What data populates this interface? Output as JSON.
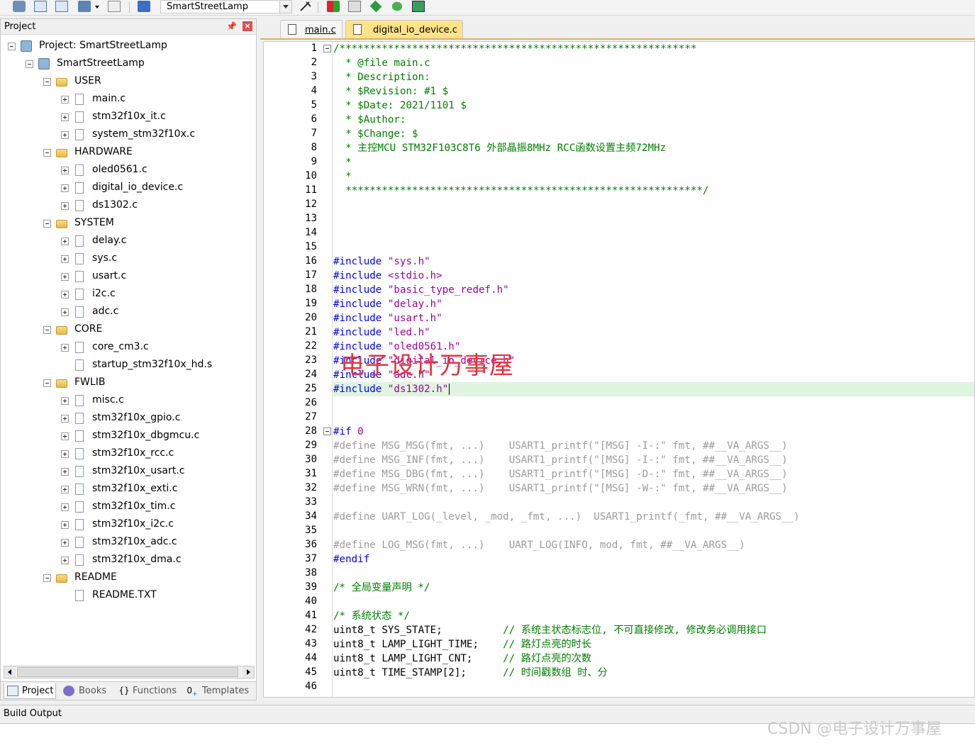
{
  "toolbar": {
    "target_name": "SmartStreetLamp",
    "icons": [
      "build-icon",
      "rebuild-icon",
      "batch-build-icon",
      "download-icon",
      "options-icon",
      "load-icon",
      "manage-icon",
      "select-packs-icon",
      "pack-installer-icon",
      "run-env-icon",
      "mgr-icon",
      "tools-icon"
    ]
  },
  "project_pane": {
    "title": "Project",
    "tree": [
      {
        "label": "Project: SmartStreetLamp",
        "kind": "project",
        "level": 0,
        "expander": "minus"
      },
      {
        "label": "SmartStreetLamp",
        "kind": "target",
        "level": 1,
        "expander": "minus"
      },
      {
        "label": "USER",
        "kind": "folder",
        "level": 2,
        "expander": "minus"
      },
      {
        "label": "main.c",
        "kind": "file",
        "level": 3,
        "expander": "plus"
      },
      {
        "label": "stm32f10x_it.c",
        "kind": "file",
        "level": 3,
        "expander": "plus"
      },
      {
        "label": "system_stm32f10x.c",
        "kind": "file",
        "level": 3,
        "expander": "plus"
      },
      {
        "label": "HARDWARE",
        "kind": "folder",
        "level": 2,
        "expander": "minus"
      },
      {
        "label": "oled0561.c",
        "kind": "file",
        "level": 3,
        "expander": "plus"
      },
      {
        "label": "digital_io_device.c",
        "kind": "file",
        "level": 3,
        "expander": "plus"
      },
      {
        "label": "ds1302.c",
        "kind": "file",
        "level": 3,
        "expander": "plus"
      },
      {
        "label": "SYSTEM",
        "kind": "folder",
        "level": 2,
        "expander": "minus"
      },
      {
        "label": "delay.c",
        "kind": "file",
        "level": 3,
        "expander": "plus"
      },
      {
        "label": "sys.c",
        "kind": "file",
        "level": 3,
        "expander": "plus"
      },
      {
        "label": "usart.c",
        "kind": "file",
        "level": 3,
        "expander": "plus"
      },
      {
        "label": "i2c.c",
        "kind": "file",
        "level": 3,
        "expander": "plus"
      },
      {
        "label": "adc.c",
        "kind": "file",
        "level": 3,
        "expander": "plus"
      },
      {
        "label": "CORE",
        "kind": "folder",
        "level": 2,
        "expander": "minus"
      },
      {
        "label": "core_cm3.c",
        "kind": "file",
        "level": 3,
        "expander": "plus"
      },
      {
        "label": "startup_stm32f10x_hd.s",
        "kind": "file",
        "level": 3,
        "expander": "none"
      },
      {
        "label": "FWLIB",
        "kind": "folder",
        "level": 2,
        "expander": "minus"
      },
      {
        "label": "misc.c",
        "kind": "file",
        "level": 3,
        "expander": "plus"
      },
      {
        "label": "stm32f10x_gpio.c",
        "kind": "file",
        "level": 3,
        "expander": "plus"
      },
      {
        "label": "stm32f10x_dbgmcu.c",
        "kind": "file",
        "level": 3,
        "expander": "plus"
      },
      {
        "label": "stm32f10x_rcc.c",
        "kind": "file",
        "level": 3,
        "expander": "plus"
      },
      {
        "label": "stm32f10x_usart.c",
        "kind": "file",
        "level": 3,
        "expander": "plus"
      },
      {
        "label": "stm32f10x_exti.c",
        "kind": "file",
        "level": 3,
        "expander": "plus"
      },
      {
        "label": "stm32f10x_tim.c",
        "kind": "file",
        "level": 3,
        "expander": "plus"
      },
      {
        "label": "stm32f10x_i2c.c",
        "kind": "file",
        "level": 3,
        "expander": "plus"
      },
      {
        "label": "stm32f10x_adc.c",
        "kind": "file",
        "level": 3,
        "expander": "plus"
      },
      {
        "label": "stm32f10x_dma.c",
        "kind": "file",
        "level": 3,
        "expander": "plus"
      },
      {
        "label": "README",
        "kind": "folder",
        "level": 2,
        "expander": "minus"
      },
      {
        "label": "README.TXT",
        "kind": "file",
        "level": 3,
        "expander": "none"
      }
    ],
    "tabs": [
      {
        "label": "Project",
        "icon": "project-icon",
        "active": true
      },
      {
        "label": "Books",
        "icon": "books-icon",
        "active": false
      },
      {
        "label": "Functions",
        "icon": "functions-icon",
        "active": false
      },
      {
        "label": "Templates",
        "icon": "templates-icon",
        "active": false
      }
    ]
  },
  "editor": {
    "tabs": [
      {
        "label": "main.c",
        "active": false
      },
      {
        "label": "digital_io_device.c",
        "active": true
      }
    ],
    "highlight_line": 25,
    "fold_lines": [
      1,
      28
    ],
    "lines": [
      [
        [
          "cm",
          "/***********************************************************"
        ]
      ],
      [
        [
          "cm",
          "  * @file main.c"
        ]
      ],
      [
        [
          "cm",
          "  * Description:"
        ]
      ],
      [
        [
          "cm",
          "  * $Revision: #1 $"
        ]
      ],
      [
        [
          "cm",
          "  * $Date: 2021/1101 $"
        ]
      ],
      [
        [
          "cm",
          "  * $Author:"
        ]
      ],
      [
        [
          "cm",
          "  * $Change: $"
        ]
      ],
      [
        [
          "cm",
          "  * 主控MCU STM32F103C8T6 外部晶振8MHz RCC函数设置主频72MHz"
        ]
      ],
      [
        [
          "cm",
          "  *"
        ]
      ],
      [
        [
          "cm",
          "  *"
        ]
      ],
      [
        [
          "cm",
          "  ***********************************************************/"
        ]
      ],
      [],
      [],
      [],
      [],
      [
        [
          "pp",
          "#include "
        ],
        [
          "st",
          "\"sys.h\""
        ]
      ],
      [
        [
          "pp",
          "#include "
        ],
        [
          "st",
          "<stdio.h>"
        ]
      ],
      [
        [
          "pp",
          "#include "
        ],
        [
          "st",
          "\"basic_type_redef.h\""
        ]
      ],
      [
        [
          "pp",
          "#include "
        ],
        [
          "st",
          "\"delay.h\""
        ]
      ],
      [
        [
          "pp",
          "#include "
        ],
        [
          "st",
          "\"usart.h\""
        ]
      ],
      [
        [
          "pp",
          "#include "
        ],
        [
          "st",
          "\"led.h\""
        ]
      ],
      [
        [
          "pp",
          "#include "
        ],
        [
          "st",
          "\"oled0561.h\""
        ]
      ],
      [
        [
          "pp",
          "#include "
        ],
        [
          "st",
          "\"digital_io_device.h\""
        ]
      ],
      [
        [
          "pp",
          "#include "
        ],
        [
          "st",
          "\"adc.h\""
        ]
      ],
      [
        [
          "pp",
          "#include "
        ],
        [
          "st",
          "\"ds1302.h\""
        ]
      ],
      [],
      [],
      [
        [
          "pp",
          "#if "
        ],
        [
          "st",
          "0"
        ]
      ],
      [
        [
          "gr",
          "#define "
        ],
        [
          "gr",
          "MSG_MSG(fmt, ...)    USART1_printf(\"[MSG] -I-:\" fmt, ##__VA_ARGS__)"
        ]
      ],
      [
        [
          "gr",
          "#define "
        ],
        [
          "gr",
          "MSG_INF(fmt, ...)    USART1_printf(\"[MSG] -I-:\" fmt, ##__VA_ARGS__)"
        ]
      ],
      [
        [
          "gr",
          "#define "
        ],
        [
          "gr",
          "MSG_DBG(fmt, ...)    USART1_printf(\"[MSG] -D-:\" fmt, ##__VA_ARGS__)"
        ]
      ],
      [
        [
          "gr",
          "#define "
        ],
        [
          "gr",
          "MSG_WRN(fmt, ...)    USART1_printf(\"[MSG] -W-:\" fmt, ##__VA_ARGS__)"
        ]
      ],
      [],
      [
        [
          "gr",
          "#define "
        ],
        [
          "gr",
          "UART_LOG(_level, _mod, _fmt, ...)  USART1_printf(_fmt, ##__VA_ARGS__)"
        ]
      ],
      [],
      [
        [
          "gr",
          "#define "
        ],
        [
          "gr",
          "LOG_MSG(fmt, ...)    UART_LOG(INFO, mod, fmt, ##__VA_ARGS__)"
        ]
      ],
      [
        [
          "pp",
          "#endif"
        ]
      ],
      [],
      [
        [
          "cm",
          "/* 全局变量声明 */"
        ]
      ],
      [],
      [
        [
          "cm",
          "/* 系统状态 */"
        ]
      ],
      [
        [
          "tx",
          "uint8_t SYS_STATE;          "
        ],
        [
          "cm",
          "// 系统主状态标志位, 不可直接修改, 修改务必调用接口"
        ]
      ],
      [
        [
          "tx",
          "uint8_t LAMP_LIGHT_TIME;    "
        ],
        [
          "cm",
          "// 路灯点亮的时长"
        ]
      ],
      [
        [
          "tx",
          "uint8_t LAMP_LIGHT_CNT;     "
        ],
        [
          "cm",
          "// 路灯点亮的次数"
        ]
      ],
      [
        [
          "tx",
          "uint8_t TIME_STAMP[2];      "
        ],
        [
          "cm",
          "// 时间戳数组 时、分"
        ]
      ],
      []
    ]
  },
  "watermarks": {
    "center": "电子设计万事屋",
    "corner": "CSDN @电子设计万事屋"
  },
  "build_output": {
    "title": "Build Output"
  }
}
